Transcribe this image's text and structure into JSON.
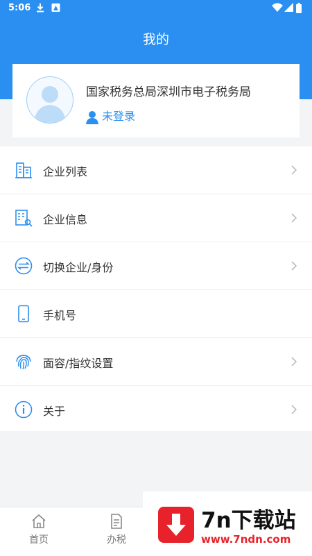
{
  "status": {
    "time": "5:06"
  },
  "header": {
    "title": "我的"
  },
  "profile": {
    "org_name": "国家税务总局深圳市电子税务局",
    "login_status": "未登录"
  },
  "menu": [
    {
      "label": "企业列表",
      "icon": "building-icon"
    },
    {
      "label": "企业信息",
      "icon": "company-info-icon"
    },
    {
      "label": "切换企业/身份",
      "icon": "switch-icon"
    },
    {
      "label": "手机号",
      "icon": "phone-icon"
    },
    {
      "label": "面容/指纹设置",
      "icon": "fingerprint-icon"
    },
    {
      "label": "关于",
      "icon": "info-icon"
    }
  ],
  "tabbar": [
    {
      "label": "首页",
      "icon": "home-icon"
    },
    {
      "label": "办税",
      "icon": "document-icon"
    }
  ],
  "watermark": {
    "title": "7n下载站",
    "url": "www.7ndn.com"
  },
  "colors": {
    "accent": "#2a8ff0",
    "watermark_red": "#e8222a"
  }
}
